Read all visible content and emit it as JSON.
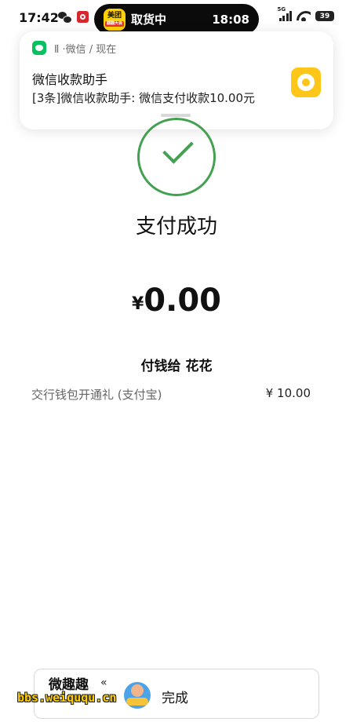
{
  "status_bar": {
    "time": "17:42",
    "island_label": "取货中",
    "island_time": "18:08",
    "island_badge": "美团",
    "island_badge_sub": "翻翻大会",
    "network": "5G",
    "battery": "39"
  },
  "notification": {
    "meta": "Ⅱ ·微信 / 现在",
    "title": "微信收款助手",
    "body": "[3条]微信收款助手: 微信支付收款10.00元"
  },
  "payment": {
    "status": "支付成功",
    "currency_symbol": "¥",
    "amount": "0.00",
    "payee": "付钱给 花花",
    "item_desc": "交行钱包开通礼 (支付宝)",
    "item_price": "¥ 10.00"
  },
  "footer": {
    "done_label": "完成",
    "watermark_top": "微趣趣",
    "watermark_url": "bbs.weiququ.cn",
    "watermark_mark": "«"
  },
  "colors": {
    "success_green": "#45a052",
    "wechat_green": "#07c160",
    "meituan_yellow": "#ffd100"
  },
  "icons": [
    "wechat-icon",
    "bank-icon",
    "signal-icon",
    "wifi-icon",
    "battery-icon",
    "checkmark-icon",
    "mascot-icon"
  ]
}
